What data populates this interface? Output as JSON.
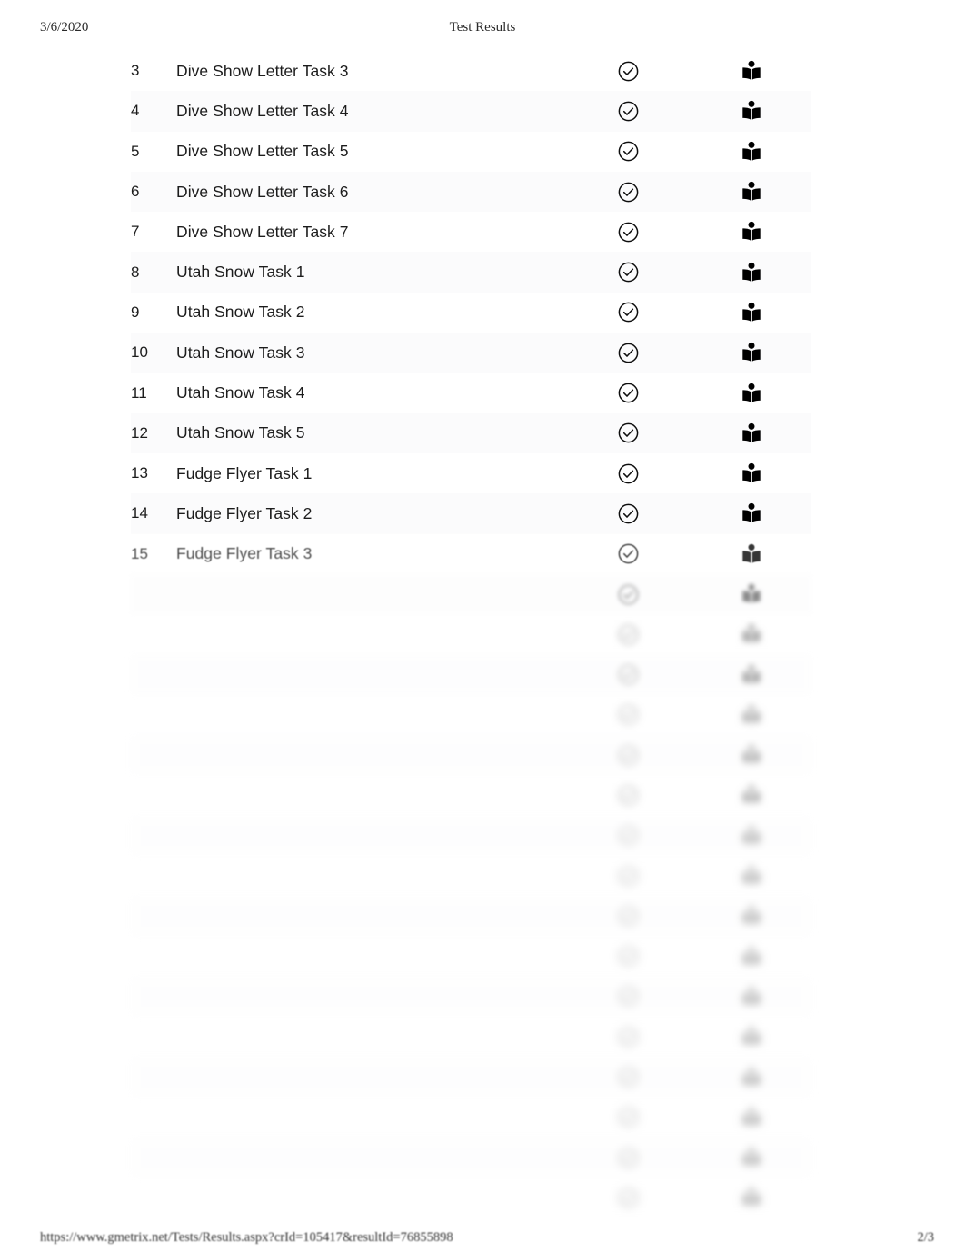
{
  "page": {
    "document_title": "Test Results",
    "background_color": "#ffffff",
    "text_color": "#1c1c1c"
  },
  "header": {
    "date": "3/6/2020",
    "title": "Test Results"
  },
  "footer": {
    "url": "https://www.gmetrix.net/Tests/Results.aspx?crId=105417&resultId=76855898",
    "page_indicator": "2/3"
  },
  "icons": {
    "status_pass": "check-circle-icon",
    "document_review": "book-reader-icon"
  },
  "table": {
    "columns": [
      "number",
      "task_name",
      "status",
      "review"
    ],
    "rows": [
      {
        "number": "3",
        "name": "Dive Show Letter Task 3",
        "status": "check-circle-icon",
        "review": "book-reader-icon",
        "blur": 0
      },
      {
        "number": "4",
        "name": "Dive Show Letter Task 4",
        "status": "check-circle-icon",
        "review": "book-reader-icon",
        "blur": 0
      },
      {
        "number": "5",
        "name": "Dive Show Letter Task 5",
        "status": "check-circle-icon",
        "review": "book-reader-icon",
        "blur": 0
      },
      {
        "number": "6",
        "name": "Dive Show Letter Task 6",
        "status": "check-circle-icon",
        "review": "book-reader-icon",
        "blur": 0
      },
      {
        "number": "7",
        "name": "Dive Show Letter Task 7",
        "status": "check-circle-icon",
        "review": "book-reader-icon",
        "blur": 0
      },
      {
        "number": "8",
        "name": "Utah Snow Task 1",
        "status": "check-circle-icon",
        "review": "book-reader-icon",
        "blur": 0
      },
      {
        "number": "9",
        "name": "Utah Snow Task 2",
        "status": "check-circle-icon",
        "review": "book-reader-icon",
        "blur": 0
      },
      {
        "number": "10",
        "name": "Utah Snow Task 3",
        "status": "check-circle-icon",
        "review": "book-reader-icon",
        "blur": 0
      },
      {
        "number": "11",
        "name": "Utah Snow Task 4",
        "status": "check-circle-icon",
        "review": "book-reader-icon",
        "blur": 0
      },
      {
        "number": "12",
        "name": "Utah Snow Task 5",
        "status": "check-circle-icon",
        "review": "book-reader-icon",
        "blur": 0
      },
      {
        "number": "13",
        "name": "Fudge Flyer Task 1",
        "status": "check-circle-icon",
        "review": "book-reader-icon",
        "blur": 0
      },
      {
        "number": "14",
        "name": "Fudge Flyer Task 2",
        "status": "check-circle-icon",
        "review": "book-reader-icon",
        "blur": 0
      },
      {
        "number": "15",
        "name": "Fudge Flyer Task 3",
        "status": "check-circle-icon",
        "review": "book-reader-icon",
        "blur": 1
      },
      {
        "number": "",
        "name": "",
        "status": "check-circle-icon",
        "review": "book-reader-icon",
        "blur": 2
      },
      {
        "number": "",
        "name": "",
        "status": "check-circle-icon",
        "review": "book-reader-icon",
        "blur": 3
      },
      {
        "number": "",
        "name": "",
        "status": "check-circle-icon",
        "review": "book-reader-icon",
        "blur": 3
      },
      {
        "number": "",
        "name": "",
        "status": "check-circle-icon",
        "review": "book-reader-icon",
        "blur": 4
      },
      {
        "number": "",
        "name": "",
        "status": "check-circle-icon",
        "review": "book-reader-icon",
        "blur": 4
      },
      {
        "number": "",
        "name": "",
        "status": "check-circle-icon",
        "review": "book-reader-icon",
        "blur": 4
      },
      {
        "number": "",
        "name": "",
        "status": "check-circle-icon",
        "review": "book-reader-icon",
        "blur": 5
      },
      {
        "number": "",
        "name": "",
        "status": "check-circle-icon",
        "review": "book-reader-icon",
        "blur": 5
      },
      {
        "number": "",
        "name": "",
        "status": "check-circle-icon",
        "review": "book-reader-icon",
        "blur": 5
      },
      {
        "number": "",
        "name": "",
        "status": "check-circle-icon",
        "review": "book-reader-icon",
        "blur": 5
      },
      {
        "number": "",
        "name": "",
        "status": "check-circle-icon",
        "review": "book-reader-icon",
        "blur": 5
      },
      {
        "number": "",
        "name": "",
        "status": "check-circle-icon",
        "review": "book-reader-icon",
        "blur": 5
      },
      {
        "number": "",
        "name": "",
        "status": "check-circle-icon",
        "review": "book-reader-icon",
        "blur": 5
      },
      {
        "number": "",
        "name": "",
        "status": "check-circle-icon",
        "review": "book-reader-icon",
        "blur": 5
      },
      {
        "number": "",
        "name": "",
        "status": "check-circle-icon",
        "review": "book-reader-icon",
        "blur": 5
      },
      {
        "number": "",
        "name": "",
        "status": "check-circle-icon",
        "review": "book-reader-icon",
        "blur": 5
      }
    ]
  }
}
